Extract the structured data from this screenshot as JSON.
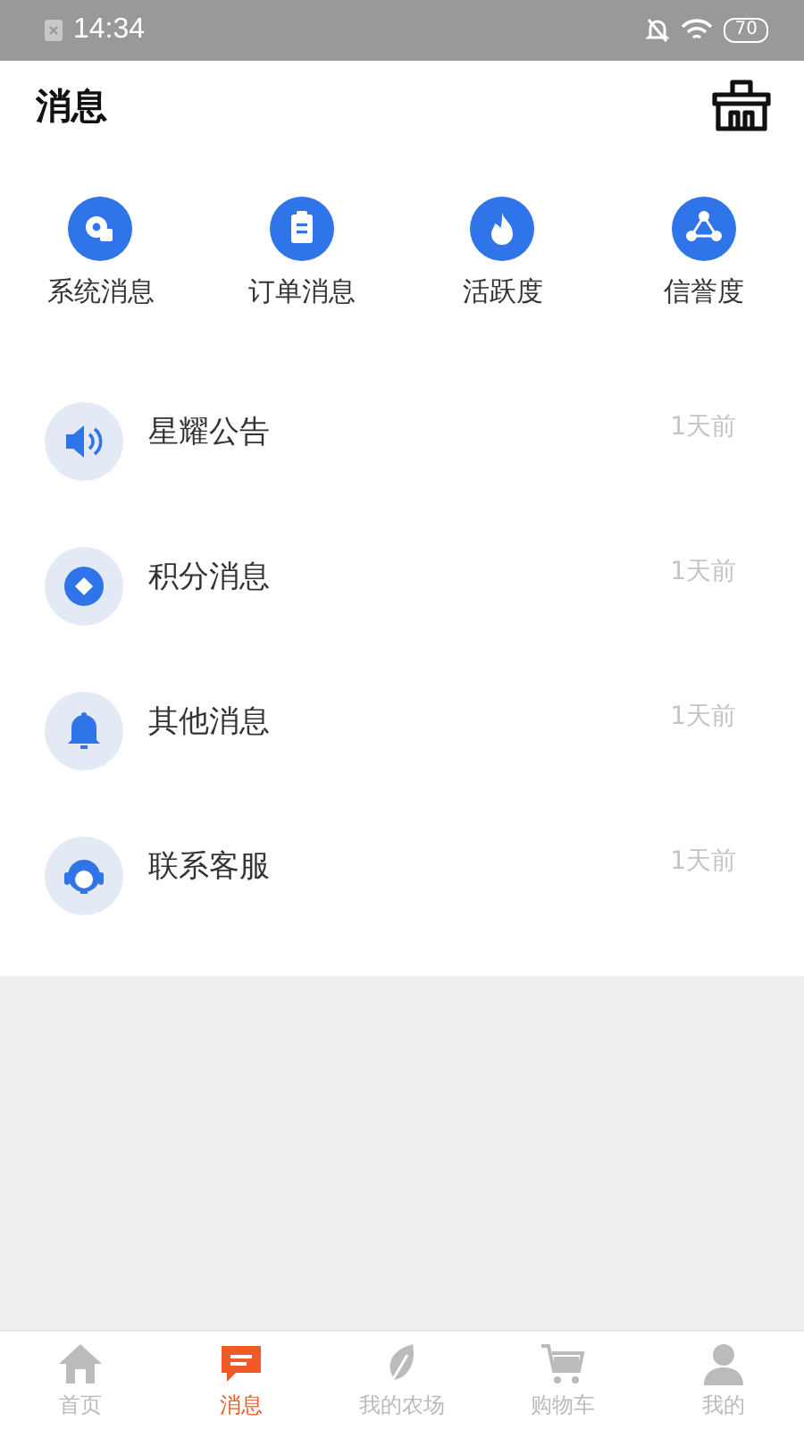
{
  "status_bar": {
    "time": "14:34",
    "battery": "70"
  },
  "header": {
    "title": "消息"
  },
  "categories": [
    {
      "kind": "system",
      "label": "系统消息"
    },
    {
      "kind": "order",
      "label": "订单消息"
    },
    {
      "kind": "activity",
      "label": "活跃度"
    },
    {
      "kind": "credit",
      "label": "信誉度"
    }
  ],
  "messages": [
    {
      "kind": "announce",
      "title": "星耀公告",
      "time": "1天前"
    },
    {
      "kind": "points",
      "title": "积分消息",
      "time": "1天前"
    },
    {
      "kind": "other",
      "title": "其他消息",
      "time": "1天前"
    },
    {
      "kind": "service",
      "title": "联系客服",
      "time": "1天前"
    }
  ],
  "tab_bar": [
    {
      "kind": "home",
      "label": "首页",
      "selected": false
    },
    {
      "kind": "message",
      "label": "消息",
      "selected": true
    },
    {
      "kind": "farm",
      "label": "我的农场",
      "selected": false
    },
    {
      "kind": "cart",
      "label": "购物车",
      "selected": false
    },
    {
      "kind": "me",
      "label": "我的",
      "selected": false
    }
  ]
}
